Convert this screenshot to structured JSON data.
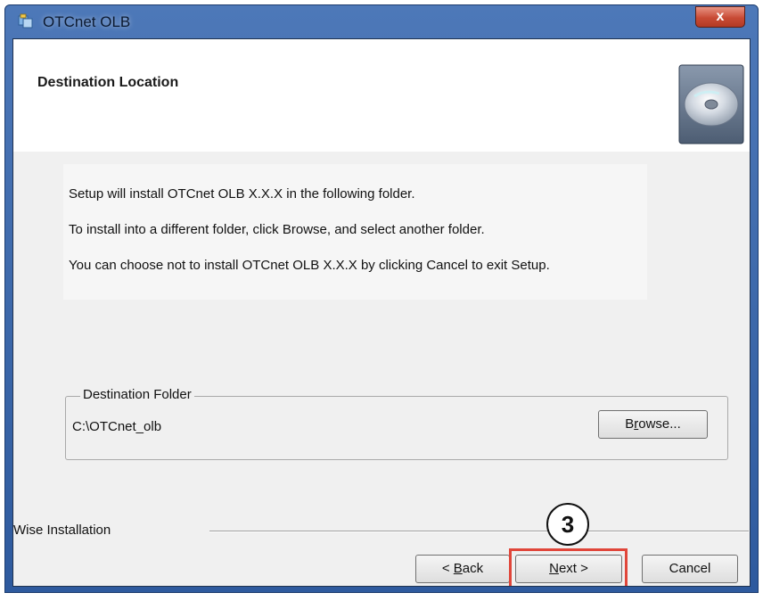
{
  "window": {
    "title": "OTCnet OLB",
    "close_label": "x"
  },
  "header": {
    "title": "Destination Location",
    "icon": "cd-disc-icon"
  },
  "instructions": {
    "line1": "Setup will install OTCnet OLB X.X.X in the following folder.",
    "line2": "To install into a different folder, click Browse, and select another folder.",
    "line3": "You can choose not to install OTCnet OLB X.X.X by clicking Cancel to exit Setup."
  },
  "destination": {
    "group_label": "Destination Folder",
    "path": "C:\\OTCnet_olb",
    "browse_accel": "r",
    "browse_rest": "owse..."
  },
  "footer": {
    "label": "Wise Installation"
  },
  "buttons": {
    "back_prefix": "< ",
    "back_accel": "B",
    "back_rest": "ack",
    "next_accel": "N",
    "next_rest": "ext >",
    "cancel": "Cancel"
  },
  "annotation": {
    "step_number": "3",
    "highlight_color": "#e0463a"
  },
  "colors": {
    "titlebar": "#4d78b8",
    "close_button": "#c84b35",
    "dialog_background": "#f0f0f0"
  }
}
